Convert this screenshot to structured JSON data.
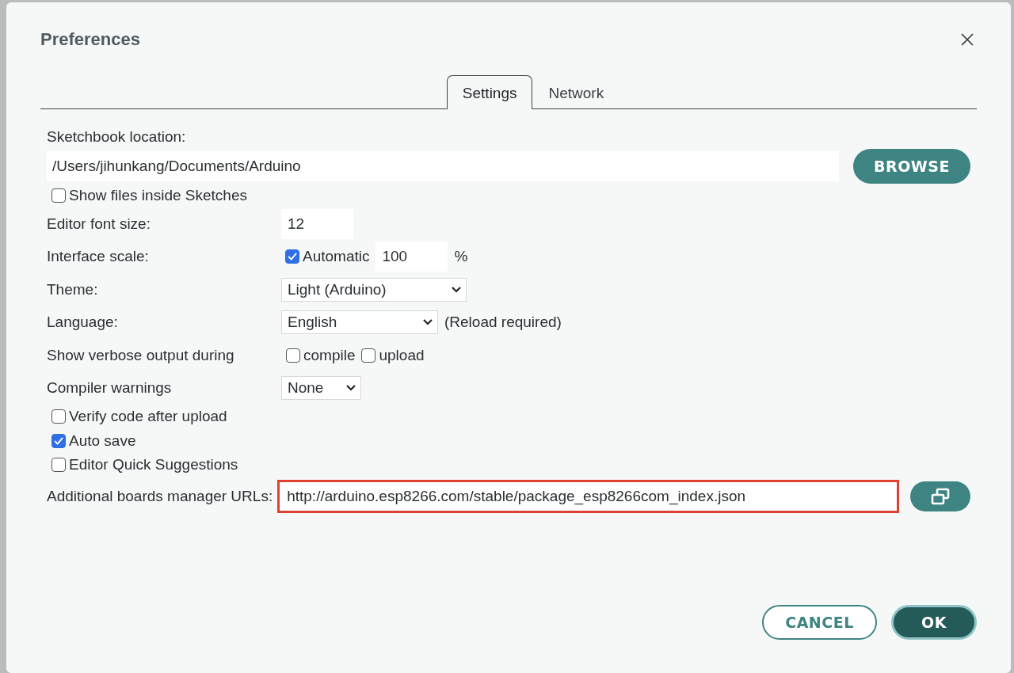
{
  "window": {
    "title": "Preferences"
  },
  "tabs": [
    {
      "label": "Settings",
      "selected": true
    },
    {
      "label": "Network",
      "selected": false
    }
  ],
  "sketchbook": {
    "label": "Sketchbook location:",
    "value": "/Users/jihunkang/Documents/Arduino",
    "button": "BROWSE"
  },
  "rows": [
    {
      "kind": "checkbox",
      "label": "Show files inside Sketches",
      "checked": false
    },
    {
      "kind": "field",
      "label": "Editor font size:",
      "value": "12"
    },
    {
      "kind": "scale",
      "label": "Interface scale:",
      "check_label": "Automatic",
      "checked": true,
      "value": "100",
      "unit": "%"
    },
    {
      "kind": "select",
      "label": "Theme:",
      "value": "Light (Arduino)"
    },
    {
      "kind": "select",
      "label": "Language:",
      "value": "English",
      "note": "(Reload required)"
    },
    {
      "kind": "checks",
      "label": "Show verbose output during",
      "options": [
        {
          "label": "compile",
          "checked": false
        },
        {
          "label": "upload",
          "checked": false
        }
      ]
    },
    {
      "kind": "select",
      "label": "Compiler warnings",
      "value": "None"
    },
    {
      "kind": "checkbox",
      "label": "Verify code after upload",
      "checked": false
    },
    {
      "kind": "checkbox",
      "label": "Auto save",
      "checked": true
    },
    {
      "kind": "checkbox",
      "label": "Editor Quick Suggestions",
      "checked": false
    },
    {
      "kind": "url",
      "label": "Additional boards manager URLs:",
      "value": "http://arduino.esp8266.com/stable/package_esp8266com_index.json",
      "highlighted": true
    }
  ],
  "buttons": [
    {
      "label": "CANCEL",
      "primary": false
    },
    {
      "label": "OK",
      "primary": true
    }
  ]
}
